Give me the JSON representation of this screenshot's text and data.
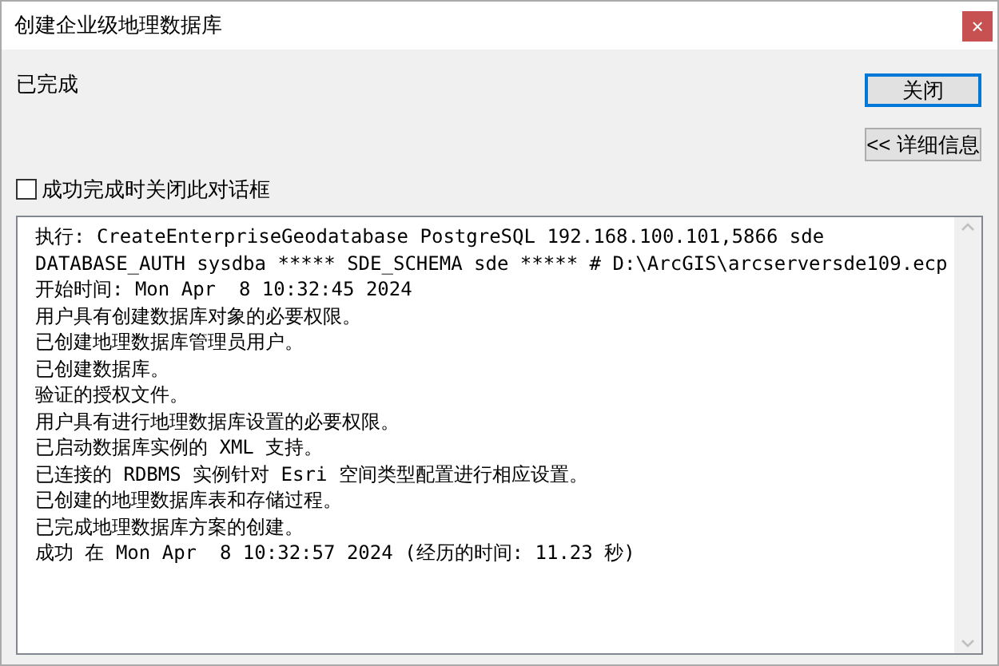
{
  "window": {
    "title": "创建企业级地理数据库",
    "close_glyph": "×"
  },
  "status": "已完成",
  "buttons": [
    {
      "label": "关闭",
      "focused": true
    },
    {
      "label": "<< 详细信息",
      "focused": false
    }
  ],
  "close_on_success": {
    "label": "成功完成时关闭此对话框",
    "checked": false
  },
  "log": [
    "执行: CreateEnterpriseGeodatabase PostgreSQL 192.168.100.101,5866 sde",
    "DATABASE_AUTH sysdba ***** SDE_SCHEMA sde ***** # D:\\ArcGIS\\arcserversde109.ecp",
    "开始时间: Mon Apr  8 10:32:45 2024",
    "用户具有创建数据库对象的必要权限。",
    "已创建地理数据库管理员用户。",
    "已创建数据库。",
    "验证的授权文件。",
    "用户具有进行地理数据库设置的必要权限。",
    "已启动数据库实例的 XML 支持。",
    "已连接的 RDBMS 实例针对 Esri 空间类型配置进行相应设置。",
    "已创建的地理数据库表和存储过程。",
    "已完成地理数据库方案的创建。",
    "成功 在 Mon Apr  8 10:32:57 2024 (经历的时间: 11.23 秒)"
  ]
}
